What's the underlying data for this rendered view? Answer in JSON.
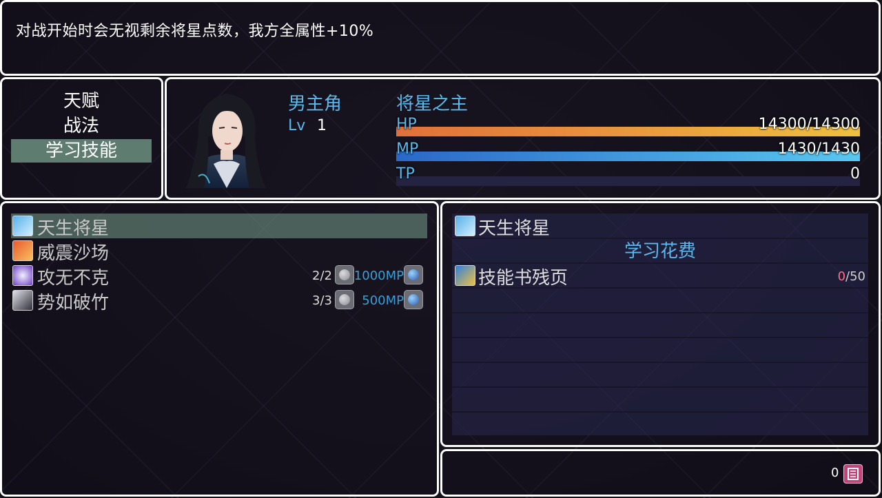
{
  "help": {
    "text": "对战开始时会无视剩余将星点数，我方全属性+10%"
  },
  "commands": [
    {
      "label": "天赋",
      "selected": false
    },
    {
      "label": "战法",
      "selected": false
    },
    {
      "label": "学习技能",
      "selected": true
    }
  ],
  "actor": {
    "name": "男主角",
    "level_label": "Lv",
    "level": "1",
    "nickname": "将星之主",
    "hp": {
      "label": "HP",
      "text": "14300/14300",
      "ratio": 1.0,
      "color_from": "#e0703a",
      "color_to": "#f0c040"
    },
    "mp": {
      "label": "MP",
      "text": "1430/1430",
      "ratio": 1.0,
      "color_from": "#2a68c8",
      "color_to": "#58c8f0"
    },
    "tp": {
      "label": "TP",
      "text": "0",
      "ratio": 0.0,
      "color_from": "#40b040",
      "color_to": "#80e080"
    }
  },
  "skills": [
    {
      "name": "天生将星",
      "icon": "star-general-icon",
      "count": "",
      "cost": "",
      "selected": true
    },
    {
      "name": "威震沙场",
      "icon": "flame-sword-icon",
      "count": "",
      "cost": "",
      "selected": false
    },
    {
      "name": "攻无不克",
      "icon": "lightning-burst-icon",
      "count": "2/2",
      "cost": "1000MP",
      "selected": false
    },
    {
      "name": "势如破竹",
      "icon": "shadow-claw-icon",
      "count": "3/3",
      "cost": "500MP",
      "selected": false
    }
  ],
  "detail": {
    "skill_name": "天生将星",
    "cost_title": "学习花费",
    "requirements": [
      {
        "name": "技能书残页",
        "icon": "scroll-key-icon",
        "have": "0",
        "need": "50"
      }
    ]
  },
  "gold": {
    "value": "0",
    "icon": "currency-icon"
  }
}
